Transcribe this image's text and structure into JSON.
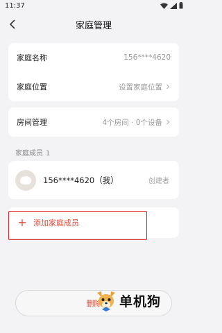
{
  "status_bar": {
    "time": "11:37"
  },
  "header": {
    "title": "家庭管理"
  },
  "family_info": {
    "name_label": "家庭名称",
    "name_value": "156****4620",
    "location_label": "家庭位置",
    "location_value": "设置家庭位置"
  },
  "rooms": {
    "label": "房间管理",
    "value": "4个房间 · 0个设备"
  },
  "members_section": {
    "label": "家庭成员",
    "count": "1",
    "members": [
      {
        "name": "156****4620（我）",
        "role": "创建者"
      }
    ],
    "add_label": "添加家庭成员"
  },
  "delete_button": {
    "label": "删除家"
  },
  "watermark": {
    "text": "单机狗"
  },
  "colors": {
    "accent": "#e24b3b",
    "highlight_box": "#e02424",
    "background": "#f3f3f5"
  }
}
